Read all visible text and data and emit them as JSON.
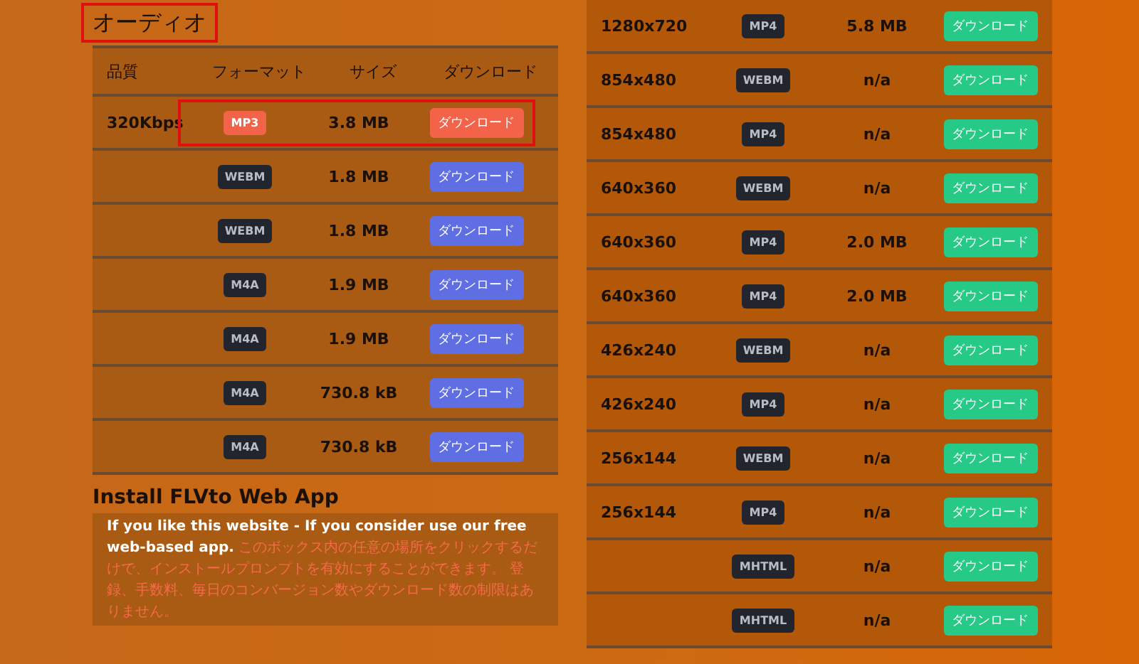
{
  "audio": {
    "title": "オーディオ",
    "columns": [
      "品質",
      "フォーマット",
      "サイズ",
      "ダウンロード"
    ],
    "rows": [
      {
        "quality": "320Kbps",
        "format": "MP3",
        "size": "3.8 MB",
        "button": "ダウンロード",
        "highlighted": true
      },
      {
        "quality": "",
        "format": "WEBM",
        "size": "1.8 MB",
        "button": "ダウンロード",
        "highlighted": false
      },
      {
        "quality": "",
        "format": "WEBM",
        "size": "1.8 MB",
        "button": "ダウンロード",
        "highlighted": false
      },
      {
        "quality": "",
        "format": "M4A",
        "size": "1.9 MB",
        "button": "ダウンロード",
        "highlighted": false
      },
      {
        "quality": "",
        "format": "M4A",
        "size": "1.9 MB",
        "button": "ダウンロード",
        "highlighted": false
      },
      {
        "quality": "",
        "format": "M4A",
        "size": "730.8 kB",
        "button": "ダウンロード",
        "highlighted": false
      },
      {
        "quality": "",
        "format": "M4A",
        "size": "730.8 kB",
        "button": "ダウンロード",
        "highlighted": false
      }
    ]
  },
  "install": {
    "title": "Install FLVto Web App",
    "lead": "If you like this website - If you consider use our free web-based app.",
    "body": "このボックス内の任意の場所をクリックするだけで、インストールプロンプトを有効にすることができます。 登録、手数料、毎日のコンバージョン数やダウンロード数の制限はありません。"
  },
  "video": {
    "rows": [
      {
        "quality": "1280x720",
        "format": "MP4",
        "size": "5.8 MB",
        "button": "ダウンロード"
      },
      {
        "quality": "854x480",
        "format": "WEBM",
        "size": "n/a",
        "button": "ダウンロード"
      },
      {
        "quality": "854x480",
        "format": "MP4",
        "size": "n/a",
        "button": "ダウンロード"
      },
      {
        "quality": "640x360",
        "format": "WEBM",
        "size": "n/a",
        "button": "ダウンロード"
      },
      {
        "quality": "640x360",
        "format": "MP4",
        "size": "2.0 MB",
        "button": "ダウンロード"
      },
      {
        "quality": "640x360",
        "format": "MP4",
        "size": "2.0 MB",
        "button": "ダウンロード"
      },
      {
        "quality": "426x240",
        "format": "WEBM",
        "size": "n/a",
        "button": "ダウンロード"
      },
      {
        "quality": "426x240",
        "format": "MP4",
        "size": "n/a",
        "button": "ダウンロード"
      },
      {
        "quality": "256x144",
        "format": "WEBM",
        "size": "n/a",
        "button": "ダウンロード"
      },
      {
        "quality": "256x144",
        "format": "MP4",
        "size": "n/a",
        "button": "ダウンロード"
      },
      {
        "quality": "",
        "format": "MHTML",
        "size": "n/a",
        "button": "ダウンロード"
      },
      {
        "quality": "",
        "format": "MHTML",
        "size": "n/a",
        "button": "ダウンロード"
      }
    ]
  }
}
